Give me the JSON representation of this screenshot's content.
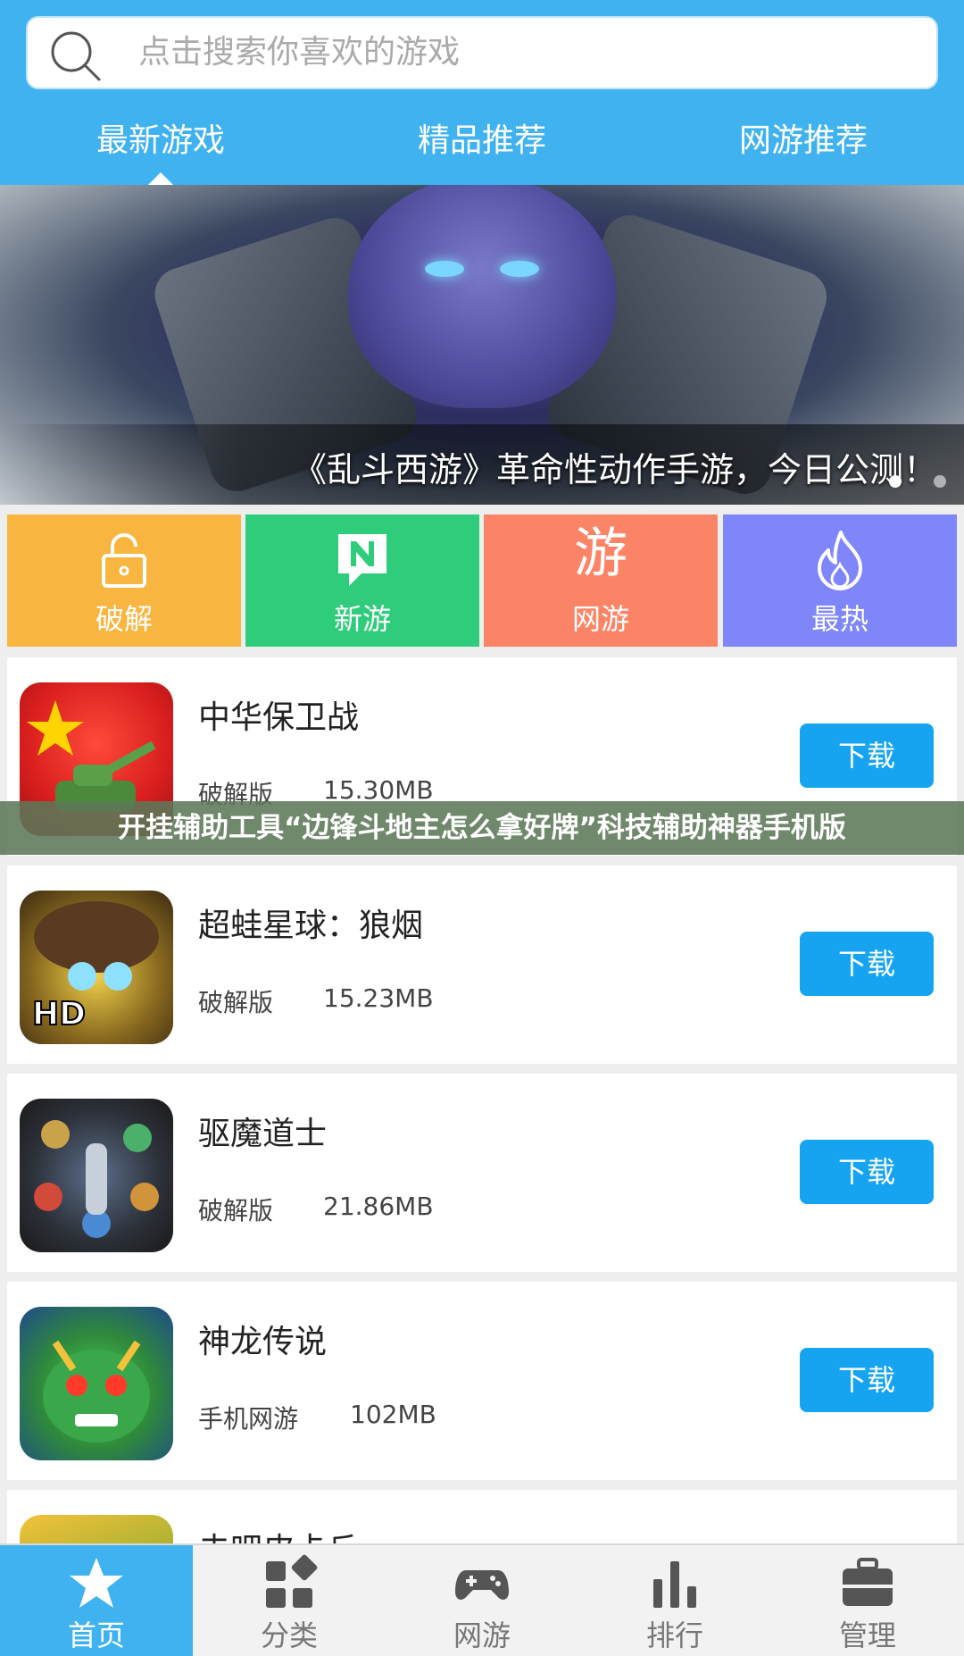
{
  "search": {
    "placeholder": "点击搜索你喜欢的游戏"
  },
  "tabs": [
    {
      "label": "最新游戏",
      "active": true
    },
    {
      "label": "精品推荐",
      "active": false
    },
    {
      "label": "网游推荐",
      "active": false
    }
  ],
  "banner": {
    "caption": "《乱斗西游》革命性动作手游，今日公测！",
    "slide_index": 1,
    "slide_count": 2
  },
  "categories": [
    {
      "label": "破解",
      "icon": "unlock-icon",
      "color": "#f8b53f"
    },
    {
      "label": "新游",
      "icon": "new-badge-icon",
      "color": "#2fcd7b"
    },
    {
      "label": "网游",
      "icon": "you-glyph-icon",
      "glyph": "游",
      "color": "#fc8466"
    },
    {
      "label": "最热",
      "icon": "flame-icon",
      "color": "#7e86fa"
    }
  ],
  "apps": [
    {
      "name": "中华保卫战",
      "type": "破解版",
      "size": "15.30MB",
      "action": "下载"
    },
    {
      "name": "超蛙星球：狼烟",
      "type": "破解版",
      "size": "15.23MB",
      "action": "下载"
    },
    {
      "name": "驱魔道士",
      "type": "破解版",
      "size": "21.86MB",
      "action": "下载"
    },
    {
      "name": "神龙传说",
      "type": "手机网游",
      "size": "102MB",
      "action": "下载"
    },
    {
      "name": "去吧皮卡丘",
      "type": "",
      "size": "",
      "action": ""
    }
  ],
  "overlay_text": "开挂辅助工具“边锋斗地主怎么拿好牌”科技辅助神器手机版",
  "bottom_nav": [
    {
      "label": "首页",
      "icon": "star-icon",
      "active": true
    },
    {
      "label": "分类",
      "icon": "category-grid-icon",
      "active": false
    },
    {
      "label": "网游",
      "icon": "gamepad-icon",
      "active": false
    },
    {
      "label": "排行",
      "icon": "bar-chart-icon",
      "active": false
    },
    {
      "label": "管理",
      "icon": "toolbox-icon",
      "active": false
    }
  ],
  "colors": {
    "primary": "#3fb2ef",
    "download_button": "#16a4f0"
  }
}
